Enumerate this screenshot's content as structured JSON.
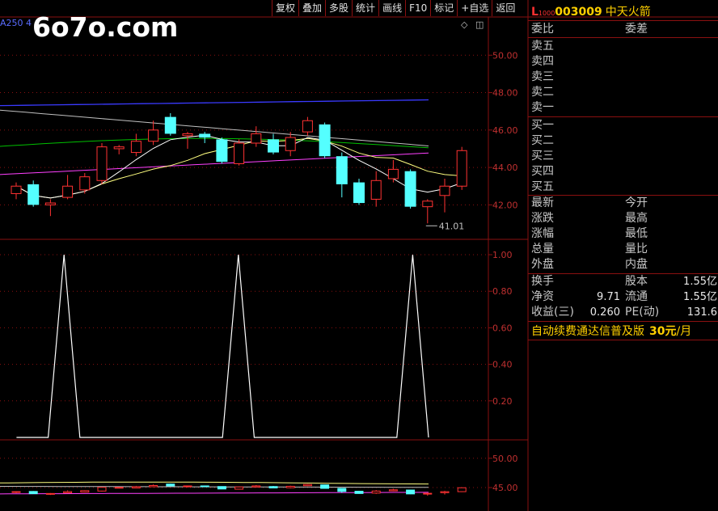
{
  "watermark": "6o7o.com",
  "ma_label": "A250  4",
  "toolbar": [
    "复权",
    "叠加",
    "多股",
    "统计",
    "画线",
    "F10",
    "标记",
    "+自选",
    "返回"
  ],
  "quote": {
    "market_letter": "L",
    "market_sub": "1000",
    "code": "003009",
    "name": "中天火箭",
    "weibi_label": "委比",
    "weicha_label": "委差",
    "sell_labels": [
      "卖五",
      "卖四",
      "卖三",
      "卖二",
      "卖一"
    ],
    "buy_labels": [
      "买一",
      "买二",
      "买三",
      "买四",
      "买五"
    ],
    "stats_left": [
      "最新",
      "涨跌",
      "涨幅",
      "总量",
      "外盘"
    ],
    "stats_right": [
      "今开",
      "最高",
      "最低",
      "量比",
      "内盘"
    ],
    "fin_left": [
      "换手",
      "净资",
      "收益(三)"
    ],
    "fin_left_vals": [
      "",
      "9.71",
      "0.260"
    ],
    "fin_right": [
      "股本",
      "流通",
      "PE(动)"
    ],
    "fin_right_vals": [
      "1.55亿",
      "1.55亿",
      "131.6"
    ],
    "promo_text": "自动续费通达信普及版",
    "promo_price": "30元",
    "promo_unit": "/月"
  },
  "colors": {
    "up": "#ff3232",
    "down": "#54ffff",
    "ma_blue": "#3a3aff",
    "ma_gray": "#c0c0c0",
    "ma_green": "#00c000",
    "ma_magenta": "#ff40ff",
    "ma_yellow": "#ffff80",
    "ma_white": "#ffffff",
    "grid": "#8a1010",
    "axis_text": "#c03030"
  },
  "chart_data": [
    {
      "type": "candlestick",
      "y_ticks": [
        "50.00",
        "48.00",
        "46.00",
        "44.00",
        "42.00"
      ],
      "y_tick_values": [
        50,
        48,
        46,
        44,
        42
      ],
      "ylim": [
        40.2,
        52.0
      ],
      "low_annotation": "41.01",
      "low_annotation_value": 41.01,
      "candles": [
        {
          "o": 42.6,
          "c": 43.0,
          "h": 43.2,
          "l": 42.3
        },
        {
          "o": 43.1,
          "c": 42.0,
          "h": 43.3,
          "l": 41.9
        },
        {
          "o": 42.0,
          "c": 42.1,
          "h": 42.3,
          "l": 41.4
        },
        {
          "o": 42.4,
          "c": 43.0,
          "h": 43.6,
          "l": 42.3
        },
        {
          "o": 42.8,
          "c": 43.5,
          "h": 43.7,
          "l": 42.6
        },
        {
          "o": 43.3,
          "c": 45.1,
          "h": 45.3,
          "l": 43.1
        },
        {
          "o": 45.0,
          "c": 45.1,
          "h": 45.2,
          "l": 44.7
        },
        {
          "o": 44.8,
          "c": 45.4,
          "h": 45.8,
          "l": 44.6
        },
        {
          "o": 45.4,
          "c": 46.0,
          "h": 46.5,
          "l": 45.2
        },
        {
          "o": 46.7,
          "c": 45.8,
          "h": 46.9,
          "l": 45.7
        },
        {
          "o": 45.7,
          "c": 45.8,
          "h": 45.9,
          "l": 45.0
        },
        {
          "o": 45.8,
          "c": 45.6,
          "h": 45.9,
          "l": 45.3
        },
        {
          "o": 45.5,
          "c": 44.3,
          "h": 45.6,
          "l": 44.2
        },
        {
          "o": 44.2,
          "c": 45.3,
          "h": 45.5,
          "l": 44.1
        },
        {
          "o": 45.3,
          "c": 45.8,
          "h": 46.2,
          "l": 45.1
        },
        {
          "o": 45.5,
          "c": 44.8,
          "h": 45.8,
          "l": 44.7
        },
        {
          "o": 44.9,
          "c": 45.6,
          "h": 45.9,
          "l": 44.6
        },
        {
          "o": 45.9,
          "c": 46.5,
          "h": 46.7,
          "l": 45.7
        },
        {
          "o": 46.3,
          "c": 44.6,
          "h": 46.4,
          "l": 44.5
        },
        {
          "o": 44.6,
          "c": 43.1,
          "h": 44.8,
          "l": 42.4
        },
        {
          "o": 43.2,
          "c": 42.1,
          "h": 43.4,
          "l": 42.0
        },
        {
          "o": 42.3,
          "c": 43.3,
          "h": 43.8,
          "l": 41.9
        },
        {
          "o": 43.4,
          "c": 43.9,
          "h": 44.4,
          "l": 43.2
        },
        {
          "o": 43.8,
          "c": 41.9,
          "h": 43.9,
          "l": 41.8
        },
        {
          "o": 41.9,
          "c": 42.2,
          "h": 42.3,
          "l": 41.01
        },
        {
          "o": 42.5,
          "c": 43.0,
          "h": 43.4,
          "l": 41.6
        },
        {
          "o": 43.0,
          "c": 44.9,
          "h": 45.1,
          "l": 42.8
        }
      ]
    },
    {
      "type": "line",
      "y_ticks": [
        "1.00",
        "0.80",
        "0.60",
        "0.40",
        "0.20"
      ],
      "y_tick_values": [
        1.0,
        0.8,
        0.6,
        0.4,
        0.2
      ],
      "ylim": [
        0.0,
        1.0
      ],
      "values": [
        0,
        0,
        0,
        1,
        0,
        0,
        0,
        0,
        0,
        0,
        0,
        0,
        0,
        0,
        1,
        0,
        0,
        0,
        0,
        0,
        0,
        0,
        0,
        0,
        0,
        1,
        0
      ]
    },
    {
      "type": "line",
      "y_ticks": [
        "50.00",
        "45.00"
      ],
      "y_tick_values": [
        50,
        45
      ],
      "ylim": [
        41.0,
        53.0
      ]
    }
  ]
}
